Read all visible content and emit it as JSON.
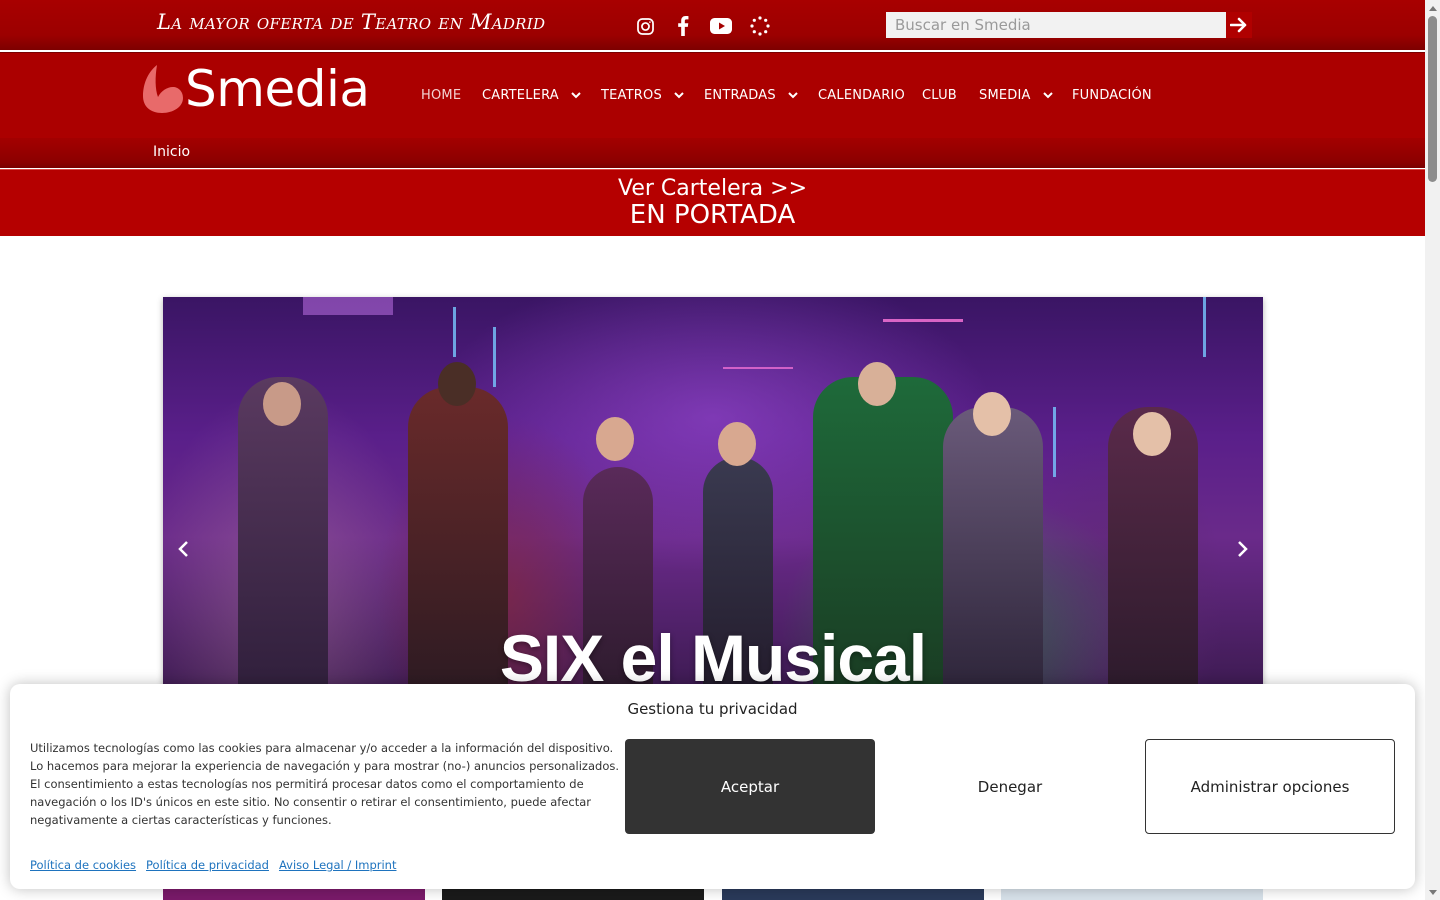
{
  "header": {
    "tagline": "La mayor oferta de Teatro en Madrid",
    "social": [
      "instagram-icon",
      "facebook-icon",
      "youtube-icon",
      "dots-ring-icon"
    ],
    "search": {
      "placeholder": "Buscar en Smedia",
      "value": ""
    }
  },
  "logo": {
    "text": "Smedia"
  },
  "nav": [
    {
      "label": "HOME",
      "active": true,
      "dropdown": false
    },
    {
      "label": "CARTELERA",
      "active": false,
      "dropdown": true
    },
    {
      "label": "TEATROS",
      "active": false,
      "dropdown": true
    },
    {
      "label": "ENTRADAS",
      "active": false,
      "dropdown": true
    },
    {
      "label": "CALENDARIO",
      "active": false,
      "dropdown": false
    },
    {
      "label": "CLUB",
      "active": false,
      "dropdown": false
    },
    {
      "label": "SMEDIA",
      "active": false,
      "dropdown": true
    },
    {
      "label": "FUNDACIÓN",
      "active": false,
      "dropdown": false
    }
  ],
  "breadcrumb": {
    "label": "Inicio"
  },
  "banner": {
    "link": "Ver Cartelera >>",
    "heading": "EN PORTADA"
  },
  "hero": {
    "title": "SIX el Musical"
  },
  "cookie": {
    "title": "Gestiona tu privacidad",
    "text": "Utilizamos tecnologías como las cookies para almacenar y/o acceder a la información del dispositivo. Lo hacemos para mejorar la experiencia de navegación y para mostrar (no-) anuncios personalizados. El consentimiento a estas tecnologías nos permitirá procesar datos como el comportamiento de navegación o los ID's únicos en este sitio. No consentir o retirar el consentimiento, puede afectar negativamente a ciertas características y funciones.",
    "accept": "Aceptar",
    "deny": "Denegar",
    "manage": "Administrar opciones",
    "links": [
      "Política de cookies",
      "Política de privacidad",
      "Aviso Legal / Imprint"
    ]
  },
  "colors": {
    "brand_red": "#ab0000",
    "accept_bg": "#333333",
    "link": "#1e73be"
  }
}
